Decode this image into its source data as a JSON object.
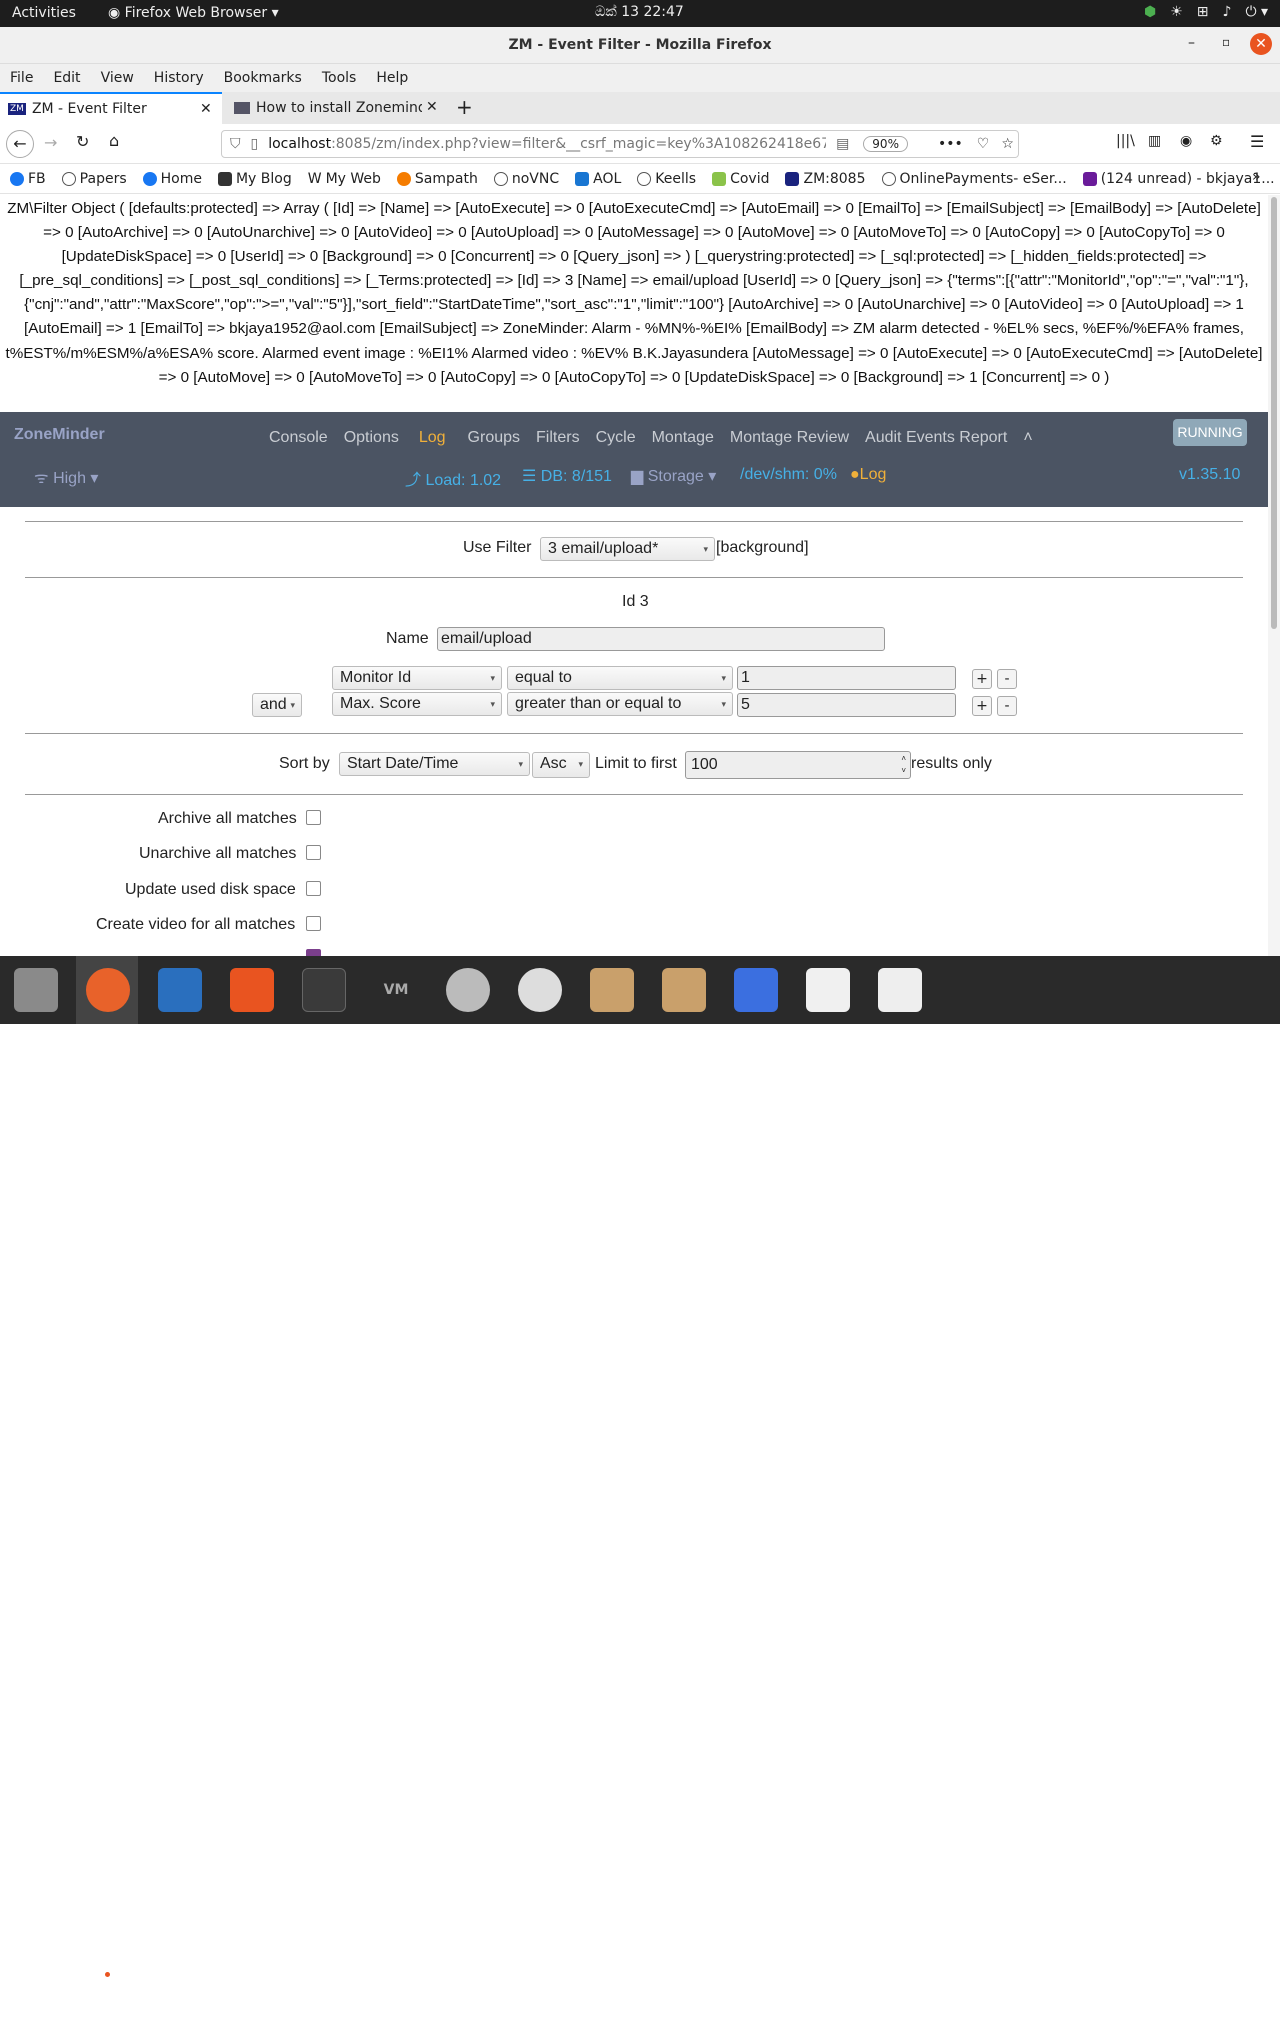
{
  "system_bar": {
    "activities": "Activities",
    "app_name": "Firefox Web Browser",
    "clock": "ඔක් 13  22:47"
  },
  "window": {
    "title": "ZM - Event Filter - Mozilla Firefox"
  },
  "menu": [
    "File",
    "Edit",
    "View",
    "History",
    "Bookmarks",
    "Tools",
    "Help"
  ],
  "tabs": [
    {
      "label": "ZM - Event Filter",
      "icon": "zm-favicon"
    },
    {
      "label": "How to install Zoneminder",
      "icon": "page-favicon"
    }
  ],
  "url": {
    "host": "localhost",
    "rest": ":8085/zm/index.php?view=filter&__csrf_magic=key%3A108262418e67",
    "zoom": "90%"
  },
  "bookmarks": [
    "FB",
    "Papers",
    "Home",
    "My Blog",
    "My Web",
    "Sampath",
    "noVNC",
    "AOL",
    "Keells",
    "Covid",
    "ZM:8085",
    "OnlinePayments- eSer...",
    "(124 unread) - bkjaya1..."
  ],
  "debug_dump": "ZM\\Filter Object ( [defaults:protected] => Array ( [Id] => [Name] => [AutoExecute] => 0 [AutoExecuteCmd] => [AutoEmail] => 0 [EmailTo] => [EmailSubject] => [EmailBody] => [AutoDelete] => 0 [AutoArchive] => 0 [AutoUnarchive] => 0 [AutoVideo] => 0 [AutoUpload] => 0 [AutoMessage] => 0 [AutoMove] => 0 [AutoMoveTo] => 0 [AutoCopy] => 0 [AutoCopyTo] => 0 [UpdateDiskSpace] => 0 [UserId] => 0 [Background] => 0 [Concurrent] => 0 [Query_json] => ) [_querystring:protected] => [_sql:protected] => [_hidden_fields:protected] => [_pre_sql_conditions] => [_post_sql_conditions] => [_Terms:protected] => [Id] => 3 [Name] => email/upload [UserId] => 0 [Query_json] => {\"terms\":[{\"attr\":\"MonitorId\",\"op\":\"=\",\"val\":\"1\"},{\"cnj\":\"and\",\"attr\":\"MaxScore\",\"op\":\">=\",\"val\":\"5\"}],\"sort_field\":\"StartDateTime\",\"sort_asc\":\"1\",\"limit\":\"100\"} [AutoArchive] => 0 [AutoUnarchive] => 0 [AutoVideo] => 0 [AutoUpload] => 1 [AutoEmail] => 1 [EmailTo] => bkjaya1952@aol.com [EmailSubject] => ZoneMinder: Alarm - %MN%-%EI% [EmailBody] => ZM alarm detected - %EL% secs, %EF%/%EFA% frames, t%EST%/m%ESM%/a%ESA% score. Alarmed event image : %EI1% Alarmed video : %EV% B.K.Jayasundera [AutoMessage] => 0 [AutoExecute] => 0 [AutoExecuteCmd] => [AutoDelete] => 0 [AutoMove] => 0 [AutoMoveTo] => 0 [AutoCopy] => 0 [AutoCopyTo] => 0 [UpdateDiskSpace] => 0 [Background] => 1 [Concurrent] => 0 )",
  "zm_nav": {
    "brand": "ZoneMinder",
    "items": [
      "Console",
      "Options",
      "Log",
      "Groups",
      "Filters",
      "Cycle",
      "Montage",
      "Montage Review",
      "Audit Events Report"
    ],
    "active": "Log",
    "status": "RUNNING",
    "bandwidth": "High",
    "load": "Load: 1.02",
    "db": "DB: 8/151",
    "storage": "Storage",
    "shm": "/dev/shm: 0%",
    "log": "Log",
    "version": "v1.35.10"
  },
  "filter": {
    "use_filter_label": "Use Filter",
    "selected_filter": "3 email/upload*",
    "background_tag": "[background]",
    "id_text": "Id 3",
    "name_label": "Name",
    "name_value": "email/upload",
    "terms": [
      {
        "cnj": "",
        "attr": "Monitor Id",
        "op": "equal to",
        "val": "1"
      },
      {
        "cnj": "and",
        "attr": "Max. Score",
        "op": "greater than or equal to",
        "val": "5"
      }
    ],
    "sort_label": "Sort by",
    "sort_field": "Start Date/Time",
    "sort_dir": "Asc",
    "limit_label": "Limit to first",
    "limit_value": "100",
    "results_only": "results only",
    "actions": [
      {
        "label": "Archive all matches",
        "checked": false
      },
      {
        "label": "Unarchive all matches",
        "checked": false
      },
      {
        "label": "Update used disk space",
        "checked": false
      },
      {
        "label": "Create video for all matches",
        "checked": false
      }
    ]
  }
}
